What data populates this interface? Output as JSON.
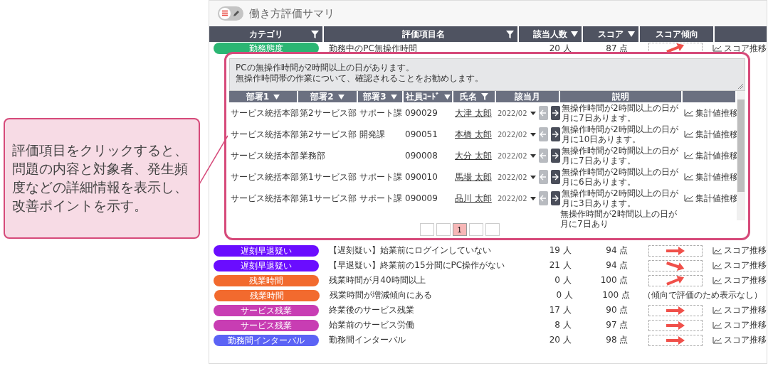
{
  "callout": {
    "text": "評価項目をクリックすると、問題の内容と対象者、発生頻度などの詳細情報を表示し、改善ポイントを示す。"
  },
  "panel": {
    "title": "働き方評価サマリ",
    "edit_mode": false
  },
  "columns": [
    {
      "label": "カテゴリ",
      "kind": "filter"
    },
    {
      "label": "評価項目名",
      "kind": "filter"
    },
    {
      "label": "該当人数",
      "kind": "sort"
    },
    {
      "label": "スコア",
      "kind": "sort"
    },
    {
      "label": "スコア傾向",
      "kind": "plain"
    }
  ],
  "rows": [
    {
      "category": "勤務態度",
      "color": "#2bb673",
      "item": "勤務中のPC無操作時間",
      "count": "20 人",
      "score": "87 点",
      "kind": "rising",
      "link": "スコア推移",
      "expanded": true
    },
    {
      "category": "遅刻早退疑い",
      "color": "#6a0dff",
      "item": "【遅刻疑い】始業前にログインしていない",
      "count": "19 人",
      "score": "94 点",
      "kind": "flat",
      "link": "スコア推移",
      "expanded": false
    },
    {
      "category": "遅刻早退疑い",
      "color": "#6a0dff",
      "item": "【早退疑い】終業前の15分間にPC操作がない",
      "count": "21 人",
      "score": "94 点",
      "kind": "falling",
      "link": "スコア推移",
      "expanded": false
    },
    {
      "category": "残業時間",
      "color": "#f26a2e",
      "item": "残業時間が月40時間以上",
      "count": "0 人",
      "score": "100 点",
      "kind": "rising",
      "link": "スコア推移",
      "expanded": false
    },
    {
      "category": "残業時間",
      "color": "#f26a2e",
      "item": "残業時間が増減傾向にある",
      "count": "0 人",
      "score": "100 点",
      "kind": "note",
      "note": "（傾向で評価のため表示なし）",
      "expanded": false
    },
    {
      "category": "サービス残業",
      "color": "#c83db3",
      "item": "終業後のサービス残業",
      "count": "17 人",
      "score": "90 点",
      "kind": "flat",
      "link": "スコア推移",
      "expanded": false
    },
    {
      "category": "サービス残業",
      "color": "#c83db3",
      "item": "始業前のサービス労働",
      "count": "8 人",
      "score": "97 点",
      "kind": "flat",
      "link": "スコア推移",
      "expanded": false
    },
    {
      "category": "勤務間インターバル",
      "color": "#5b63f5",
      "item": "勤務間インターバル",
      "count": "20 人",
      "score": "98 点",
      "kind": "flat",
      "link": "スコア推移",
      "expanded": false
    }
  ],
  "detail": {
    "message_lines": [
      "PCの無操作時間が2時間以上の日があります。",
      "無操作時間帯の作業について、確認されることをお勧めします。"
    ],
    "columns": [
      {
        "label": "部署1",
        "kind": "sort"
      },
      {
        "label": "部署2",
        "kind": "sort"
      },
      {
        "label": "部署3",
        "kind": "sort"
      },
      {
        "label": "社員ｺｰﾄﾞ",
        "kind": "sort"
      },
      {
        "label": "氏名",
        "kind": "filter"
      },
      {
        "label": "該当月",
        "kind": "plain"
      },
      {
        "label": "説明",
        "kind": "plain"
      }
    ],
    "rows": [
      {
        "kind": "full",
        "dept1": "サービス統括本部",
        "dept2": "第2サービス部",
        "dept3": "サポート課",
        "code": "090029",
        "name": "大津 太郎",
        "month": "2022/02",
        "description": "無操作時間が2時間以上の日が月に7日あります。",
        "link": "集計値推移"
      },
      {
        "kind": "full",
        "dept1": "サービス統括本部",
        "dept2": "第2サービス部",
        "dept3": "開発課",
        "code": "090051",
        "name": "本橋 太郎",
        "month": "2022/02",
        "description": "無操作時間が2時間以上の日が月に10日あります。",
        "link": "集計値推移"
      },
      {
        "kind": "full",
        "dept1": "サービス統括本部",
        "dept2": "業務部",
        "code": "090008",
        "name": "大分 太郎",
        "month": "2022/02",
        "description": "無操作時間が2時間以上の日が月に7日あります。",
        "link": "集計値推移"
      },
      {
        "kind": "full",
        "dept1": "サービス統括本部",
        "dept2": "第1サービス部",
        "dept3": "サポート課",
        "code": "090010",
        "name": "馬場 太郎",
        "month": "2022/02",
        "description": "無操作時間が2時間以上の日が月に6日あります。",
        "link": "集計値推移"
      },
      {
        "kind": "full",
        "dept1": "サービス統括本部",
        "dept2": "第1サービス部",
        "dept3": "サポート課",
        "code": "090009",
        "name": "品川 太郎",
        "month": "2022/02",
        "description": "無操作時間が2時間以上の日が月に3日あります。",
        "link": "集計値推移"
      },
      {
        "kind": "partial",
        "description": "無操作時間が2時間以上の日が月に7日あり"
      }
    ],
    "pages": [
      {
        "selected": false
      },
      {
        "selected": false
      },
      {
        "label": "1",
        "selected": true
      },
      {
        "selected": false
      },
      {
        "selected": false
      }
    ]
  }
}
